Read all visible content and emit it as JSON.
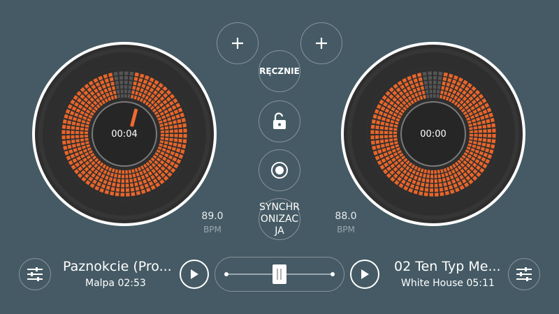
{
  "colors": {
    "background": "#455a64",
    "accent": "#e8652a",
    "platter": "#2f2f2f",
    "hub": "#262626"
  },
  "center": {
    "add_left_icon": "plus-icon",
    "add_right_icon": "plus-icon",
    "manual_label": "RĘCZNIE",
    "lock_icon": "unlock-icon",
    "record_icon": "record-icon",
    "sync_label_lines": [
      "SYNCHR",
      "ONIZAC",
      "JA"
    ]
  },
  "deck_left": {
    "time": "00:04",
    "bpm": "89.0",
    "bpm_label": "BPM",
    "title": "Paznokcie (Pro...",
    "artist_time": "Malpa 02:53",
    "progress": 0.04
  },
  "deck_right": {
    "time": "00:00",
    "bpm": "88.0",
    "bpm_label": "BPM",
    "title": "02 Ten Typ Me...",
    "artist_time": "White House 05:11",
    "progress": 0.0
  },
  "crossfader": {
    "position": 0.5
  },
  "icons": {
    "eq_left": "equalizer-icon",
    "eq_right": "equalizer-icon",
    "play_left": "play-icon",
    "play_right": "play-icon"
  }
}
